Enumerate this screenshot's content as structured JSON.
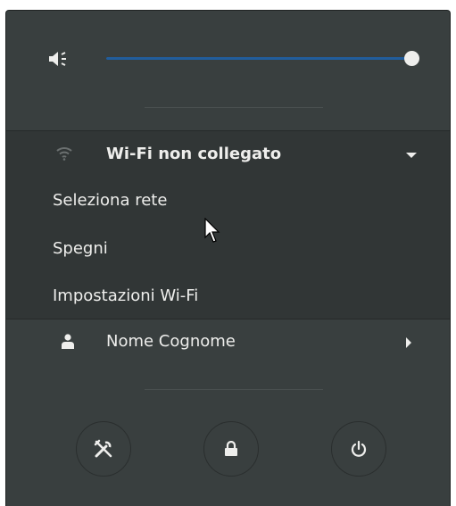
{
  "volume": {
    "icon": "audio-volume-low-icon",
    "level": 1.0
  },
  "wifi": {
    "icon": "wifi-signal-icon",
    "label": "Wi-Fi non collegato",
    "expanded": true,
    "items": [
      {
        "label": "Seleziona rete"
      },
      {
        "label": "Spegni"
      },
      {
        "label": "Impostazioni Wi-Fi"
      }
    ]
  },
  "user": {
    "icon": "user-icon",
    "label": "Nome Cognome"
  },
  "actions": {
    "settings_icon": "settings-icon",
    "lock_icon": "lock-icon",
    "power_icon": "power-icon"
  },
  "colors": {
    "background": "#393f3f",
    "accent": "#215d9c",
    "text": "#eeeeec"
  }
}
